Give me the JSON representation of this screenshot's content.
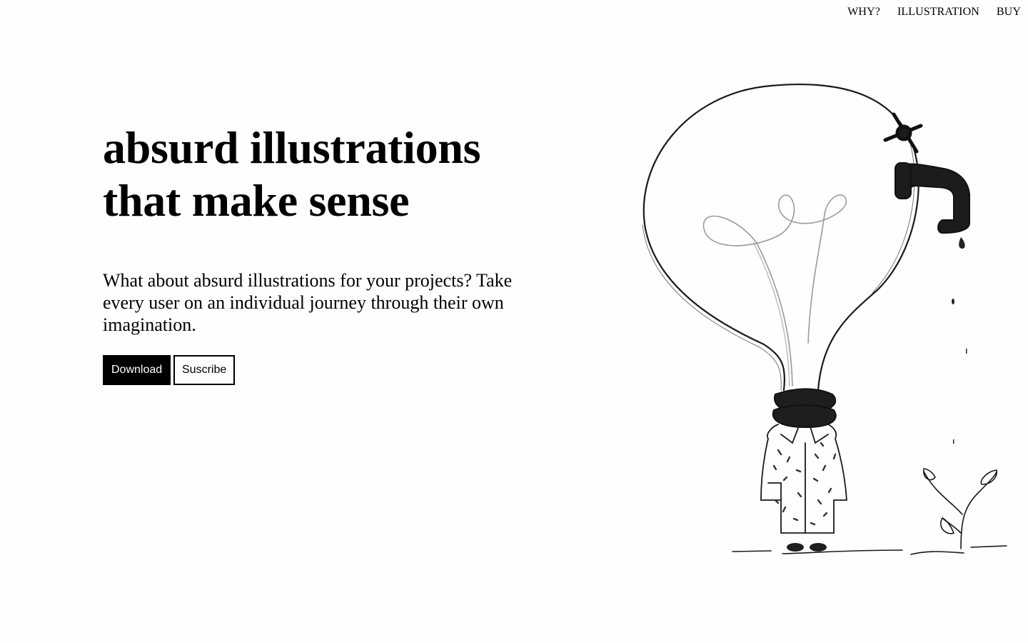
{
  "nav": {
    "items": [
      {
        "label": "WHY?"
      },
      {
        "label": "ILLUSTRATION"
      },
      {
        "label": "BUY"
      }
    ]
  },
  "hero": {
    "title_line1": "absurd illustrations",
    "title_line2": "that make sense",
    "description": "What about absurd illustrations for your projects? Take every user on an individual journey through their own imagination.",
    "download_label": "Download",
    "subscribe_label": "Suscribe"
  },
  "illustration": {
    "subject": "lightbulb-head-person-with-faucet-and-sprout"
  },
  "colors": {
    "background": "#fefefe",
    "ink": "#000000",
    "button_primary_bg": "#000000",
    "button_primary_text": "#ffffff"
  }
}
